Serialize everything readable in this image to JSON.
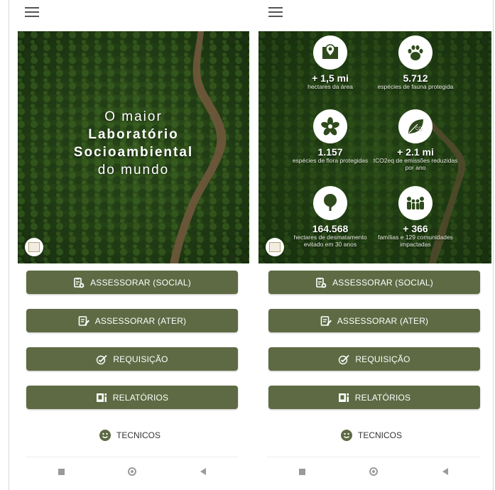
{
  "left_screen": {
    "hero": {
      "line1": "O maior",
      "line2": "Laboratório",
      "line3": "Socioambiental",
      "line4": "do mundo"
    }
  },
  "right_screen": {
    "stats": [
      {
        "icon": "map-pin-icon",
        "value": "+ 1,5 mi",
        "desc": "hectares da área"
      },
      {
        "icon": "paw-icon",
        "value": "5.712",
        "desc": "espécies de fauna protegida"
      },
      {
        "icon": "flower-icon",
        "value": "1.157",
        "desc": "espécies de flora protegidas"
      },
      {
        "icon": "leaf-co2-icon",
        "value": "+ 2.1 mi",
        "desc": "tCO2eq de emissões reduzidas por ano"
      },
      {
        "icon": "tree-icon",
        "value": "164.568",
        "desc": "hectares de desmatamento evitado em 30 anos"
      },
      {
        "icon": "family-icon",
        "value": "+ 366",
        "desc": "famílias e 129 comunidades impactadas"
      }
    ]
  },
  "buttons": {
    "social": "ASSESSORAR (SOCIAL)",
    "ater": "ASSESSORAR (ATER)",
    "requisicao": "REQUISIÇÃO",
    "relatorios": "RELATÓRIOS",
    "tecnicos": "TECNICOS"
  },
  "colors": {
    "button_bg": "#5d6a43",
    "forest": "#2c4a1a",
    "river": "#8a6b4a"
  }
}
